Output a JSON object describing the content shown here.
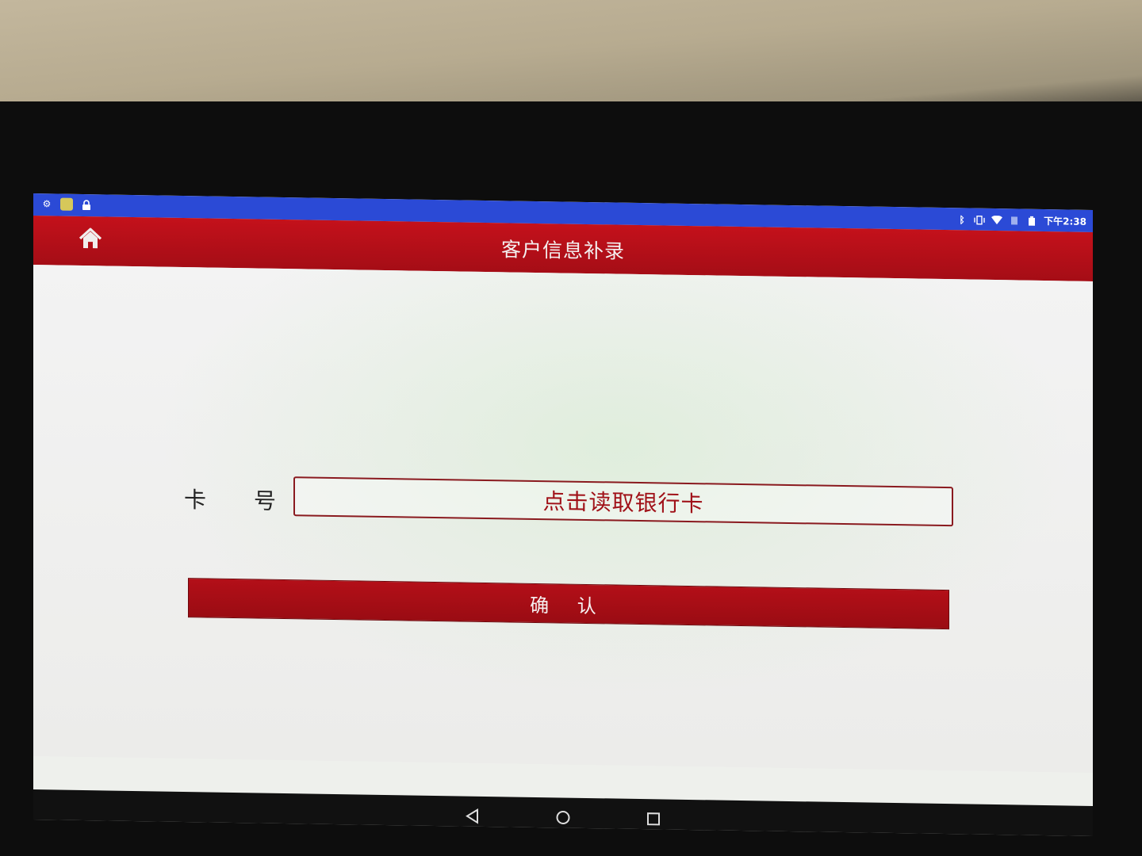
{
  "statusbar": {
    "left_icons": [
      "settings-icon",
      "app-icon",
      "lock-icon"
    ],
    "right_icons": [
      "bluetooth-icon",
      "vibrate-icon",
      "wifi-icon",
      "sim-icon",
      "battery-icon"
    ],
    "time": "下午2:38"
  },
  "topbar": {
    "title": "客户信息补录",
    "home_icon": "home-icon"
  },
  "form": {
    "card_label_1": "卡",
    "card_label_2": "号",
    "card_placeholder": "点击读取银行卡",
    "confirm_label": "确 认"
  },
  "navbar": {
    "back_icon": "back-icon",
    "home_icon": "nav-home-icon",
    "recents_icon": "recents-icon"
  },
  "colors": {
    "status_blue": "#2b4ad6",
    "header_red": "#c4111b",
    "button_red": "#b30f18"
  }
}
